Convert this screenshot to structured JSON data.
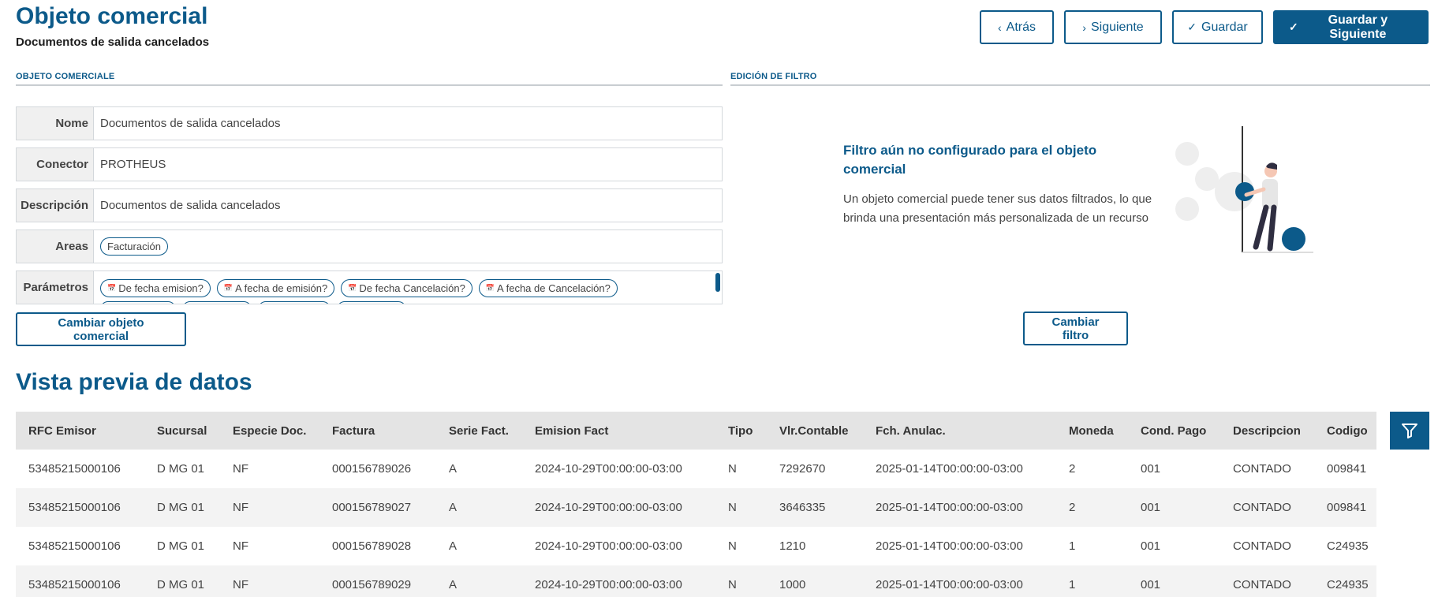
{
  "header": {
    "title": "Objeto comercial",
    "subtitle": "Documentos de salida cancelados"
  },
  "actions": {
    "back": "Atrás",
    "next": "Siguiente",
    "save": "Guardar",
    "save_next": "Guardar y Siguiente"
  },
  "sections": {
    "object": "OBJETO COMERCIALE",
    "filter": "EDICIÓN DE FILTRO"
  },
  "fields": {
    "name_label": "Nome",
    "name_value": "Documentos de salida cancelados",
    "connector_label": "Conector",
    "connector_value": "PROTHEUS",
    "description_label": "Descripción",
    "description_value": "Documentos de salida cancelados",
    "areas_label": "Areas",
    "areas": [
      "Facturación"
    ],
    "params_label": "Parámetros",
    "params": [
      "De fecha emision?",
      "A fecha de emisión?",
      "De fecha Cancelación?",
      "A fecha de Cancelación?"
    ]
  },
  "change_object_label": "Cambiar objeto comercial",
  "filter": {
    "title": "Filtro aún no configurado para el objeto comercial",
    "description": "Un objeto comercial puede tener sus datos filtrados, lo que brinda una presentación más personalizada de un recurso",
    "change_label": "Cambiar filtro"
  },
  "preview": {
    "title": "Vista previa de datos",
    "columns": [
      "RFC Emisor",
      "Sucursal",
      "Especie Doc.",
      "Factura",
      "Serie Fact.",
      "Emision Fact",
      "Tipo",
      "Vlr.Contable",
      "Fch. Anulac.",
      "Moneda",
      "Cond. Pago",
      "Descripcion",
      "Codigo"
    ],
    "rows": [
      [
        "53485215000106",
        "D MG 01",
        "NF",
        "000156789026",
        "A",
        "2024-10-29T00:00:00-03:00",
        "N",
        "7292670",
        "2025-01-14T00:00:00-03:00",
        "2",
        "001",
        "CONTADO",
        "009841"
      ],
      [
        "53485215000106",
        "D MG 01",
        "NF",
        "000156789027",
        "A",
        "2024-10-29T00:00:00-03:00",
        "N",
        "3646335",
        "2025-01-14T00:00:00-03:00",
        "2",
        "001",
        "CONTADO",
        "009841"
      ],
      [
        "53485215000106",
        "D MG 01",
        "NF",
        "000156789028",
        "A",
        "2024-10-29T00:00:00-03:00",
        "N",
        "1210",
        "2025-01-14T00:00:00-03:00",
        "1",
        "001",
        "CONTADO",
        "C24935"
      ],
      [
        "53485215000106",
        "D MG 01",
        "NF",
        "000156789029",
        "A",
        "2024-10-29T00:00:00-03:00",
        "N",
        "1000",
        "2025-01-14T00:00:00-03:00",
        "1",
        "001",
        "CONTADO",
        "C24935"
      ]
    ]
  },
  "colors": {
    "accent": "#0c5a8a",
    "header_bg": "#e4e4e4",
    "stripe": "#f3f3f3"
  }
}
